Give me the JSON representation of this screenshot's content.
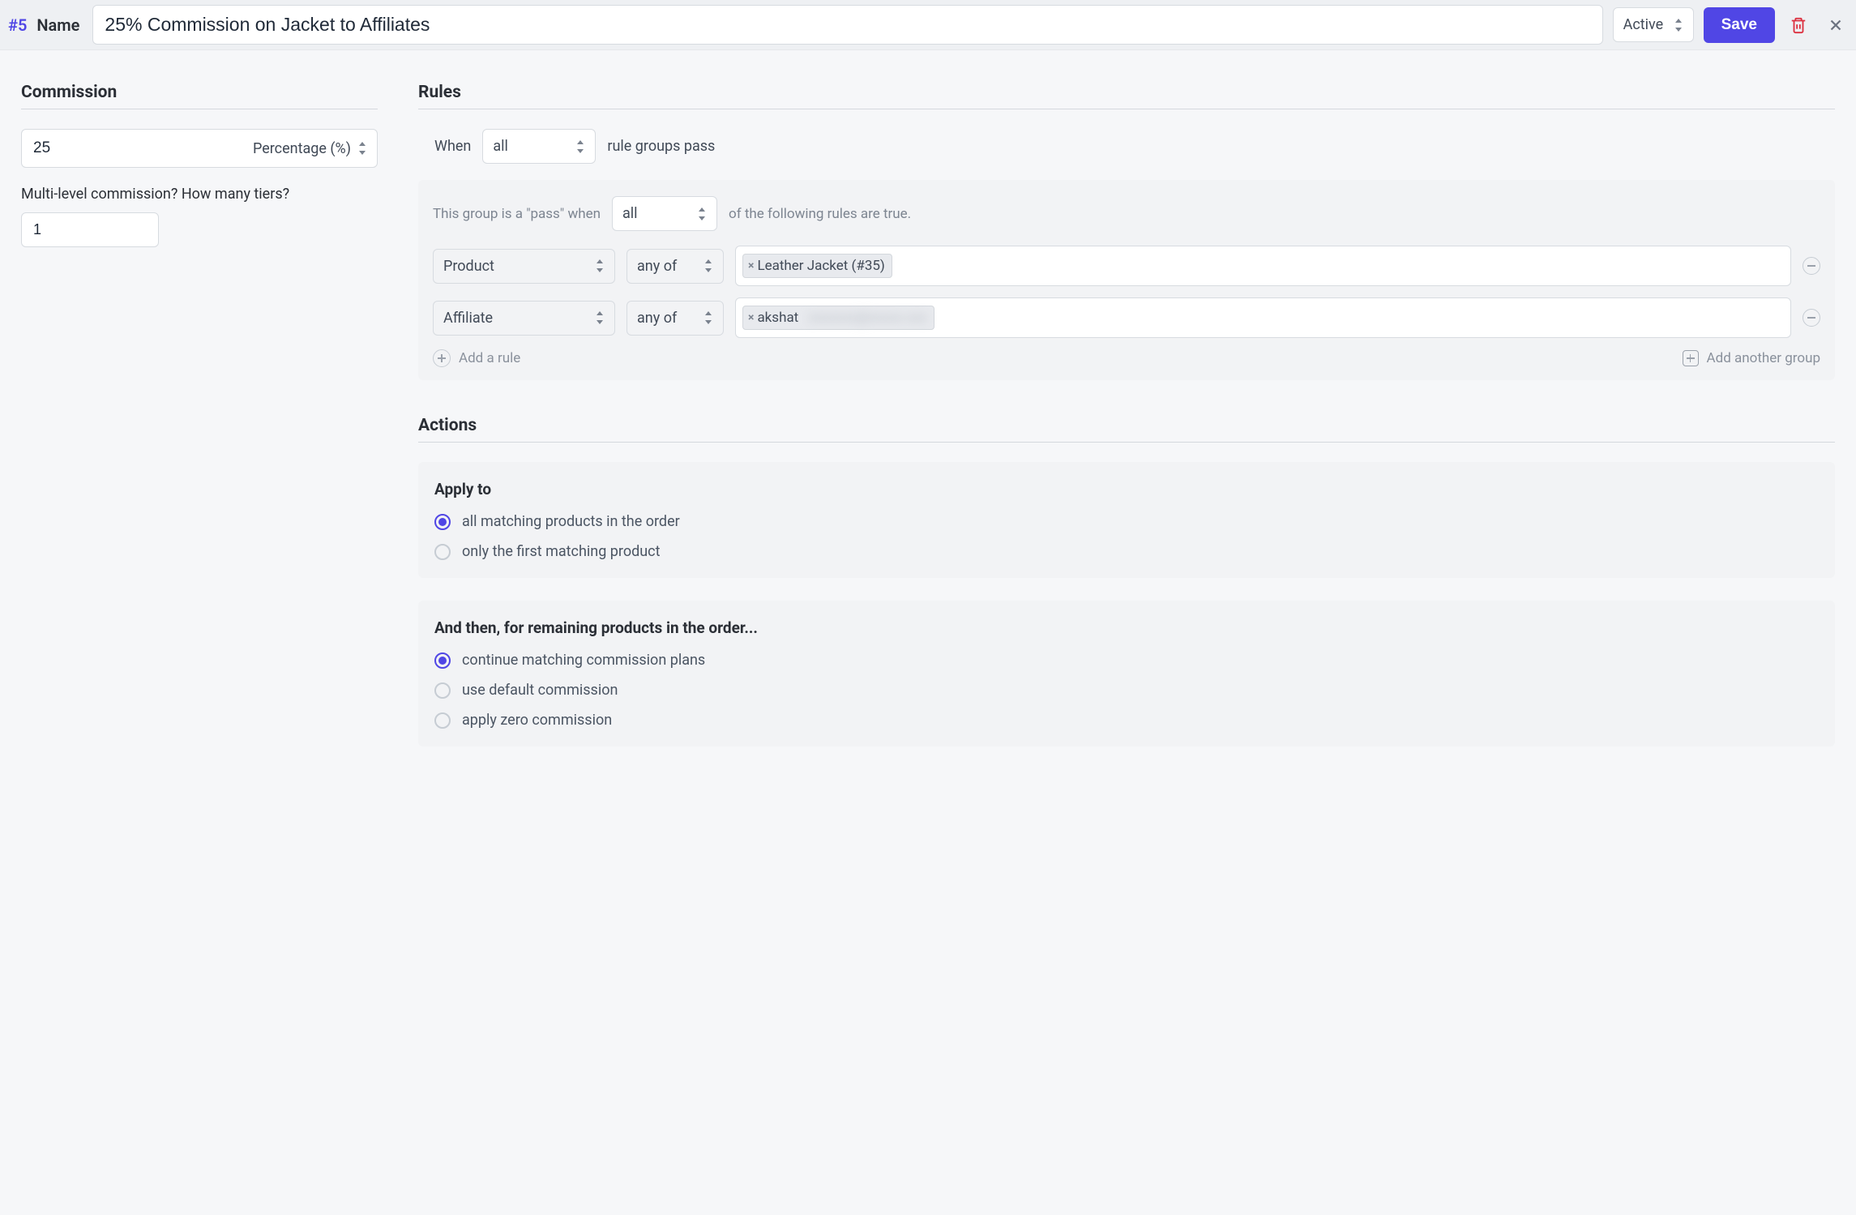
{
  "header": {
    "plan_id": "#5",
    "name_label": "Name",
    "name_value": "25% Commission on Jacket to Affiliates",
    "status": "Active",
    "save_label": "Save"
  },
  "commission": {
    "title": "Commission",
    "value": "25",
    "type": "Percentage (%)",
    "tiers_label": "Multi-level commission? How many tiers?",
    "tiers_value": "1"
  },
  "rules": {
    "title": "Rules",
    "when_label": "When",
    "when_mode": "all",
    "when_suffix": "rule groups pass",
    "group": {
      "prefix": "This group is a \"pass\" when",
      "mode": "all",
      "suffix": "of the following rules are true.",
      "rules": [
        {
          "field": "Product",
          "op": "any of",
          "tags": [
            "Leather Jacket (#35)"
          ]
        },
        {
          "field": "Affiliate",
          "op": "any of",
          "tags": [
            "akshat"
          ],
          "has_blurred_continuation": true
        }
      ],
      "add_rule_label": "Add a rule",
      "add_group_label": "Add another group"
    }
  },
  "actions": {
    "title": "Actions",
    "apply_to": {
      "heading": "Apply to",
      "options": [
        {
          "label": "all matching products in the order",
          "checked": true
        },
        {
          "label": "only the first matching product",
          "checked": false
        }
      ]
    },
    "remaining": {
      "heading": "And then, for remaining products in the order...",
      "options": [
        {
          "label": "continue matching commission plans",
          "checked": true
        },
        {
          "label": "use default commission",
          "checked": false
        },
        {
          "label": "apply zero commission",
          "checked": false
        }
      ]
    }
  }
}
